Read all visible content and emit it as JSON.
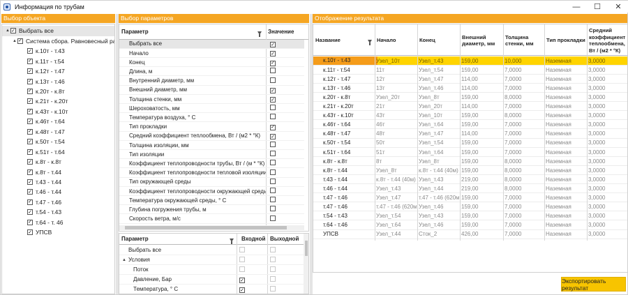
{
  "window": {
    "title": "Информация по трубам",
    "minimize": "—",
    "maximize": "☐",
    "close": "✕"
  },
  "panels": {
    "objects": "Выбор объекта",
    "params": "Выбор параметров",
    "results": "Отображение результата"
  },
  "tree": [
    {
      "label": "Выбрать все",
      "level": 0,
      "checked": true,
      "expander": "▲",
      "selected": true
    },
    {
      "label": "Система сбора. Равновесный расчет",
      "level": 1,
      "checked": true,
      "expander": "▲"
    },
    {
      "label": "к.10т - т.43",
      "level": 2,
      "checked": true
    },
    {
      "label": "к.11т - т.54",
      "level": 2,
      "checked": true
    },
    {
      "label": "к.12т - т.47",
      "level": 2,
      "checked": true
    },
    {
      "label": "к.13т - т.46",
      "level": 2,
      "checked": true
    },
    {
      "label": "к.20т - к.8т",
      "level": 2,
      "checked": true
    },
    {
      "label": "к.21т - к.20т",
      "level": 2,
      "checked": true
    },
    {
      "label": "к.43т - к.10т",
      "level": 2,
      "checked": true
    },
    {
      "label": "к.46т - т.64",
      "level": 2,
      "checked": true
    },
    {
      "label": "к.48т - т.47",
      "level": 2,
      "checked": true
    },
    {
      "label": "к.50т - т.54",
      "level": 2,
      "checked": true
    },
    {
      "label": "к.51т - т.64",
      "level": 2,
      "checked": true
    },
    {
      "label": "к.8т - к.8т",
      "level": 2,
      "checked": true
    },
    {
      "label": "к.8т - т.44",
      "level": 2,
      "checked": true
    },
    {
      "label": "т.43 - т.44",
      "level": 2,
      "checked": true
    },
    {
      "label": "т.46 - т.44",
      "level": 2,
      "checked": true
    },
    {
      "label": "т.47 - т.46",
      "level": 2,
      "checked": true
    },
    {
      "label": "т.54 - т.43",
      "level": 2,
      "checked": true
    },
    {
      "label": "т.64 - т. 46",
      "level": 2,
      "checked": true
    },
    {
      "label": "УПСВ",
      "level": 2,
      "checked": true
    }
  ],
  "params_grid": {
    "col_param": "Параметр",
    "col_value": "Значение",
    "rows": [
      {
        "name": "Выбрать все",
        "checked": true,
        "selected": true
      },
      {
        "name": "Начало",
        "checked": true
      },
      {
        "name": "Конец",
        "checked": true
      },
      {
        "name": "Длина, м",
        "checked": false
      },
      {
        "name": "Внутренний диаметр,  мм",
        "checked": false
      },
      {
        "name": "Внешний диаметр, мм",
        "checked": true
      },
      {
        "name": "Толщина стенки, мм",
        "checked": true
      },
      {
        "name": "Шероховатость, мм",
        "checked": false
      },
      {
        "name": "Температура воздуха, ° С",
        "checked": false
      },
      {
        "name": "Тип прокладки",
        "checked": true
      },
      {
        "name": "Средний коэффициент теплообмена, Вт / (м2 * °К)",
        "checked": true
      },
      {
        "name": "Толщина изоляции, мм",
        "checked": false
      },
      {
        "name": "Тип изоляции",
        "checked": false
      },
      {
        "name": "Коэффициент теплопроводности трубы, Вт / (м * °К)",
        "checked": false
      },
      {
        "name": "Коэффициент теплопроводности тепловой изоляции, Вт / (",
        "checked": false
      },
      {
        "name": "Тип окружающей среды",
        "checked": false
      },
      {
        "name": "Коэффициент теплопроводности окружающей среды, Вт / (",
        "checked": false
      },
      {
        "name": "Температура окружающей среды, ° С",
        "checked": false
      },
      {
        "name": "Глубина погружения трубы,  м",
        "checked": false
      },
      {
        "name": "Скорость ветра, м/с",
        "checked": false
      }
    ]
  },
  "io_grid": {
    "col_param": "Параметр",
    "col_in": "Входной",
    "col_out": "Выходной",
    "rows": [
      {
        "name": "Выбрать все",
        "indent": 0,
        "in": false,
        "out": false
      },
      {
        "name": "Условия",
        "indent": 0,
        "expander": "▲",
        "in": false,
        "out": false
      },
      {
        "name": "Поток",
        "indent": 1,
        "in": false,
        "out": false
      },
      {
        "name": "Давление, Бар",
        "indent": 1,
        "in": true,
        "out": false
      },
      {
        "name": "Температура, ° С",
        "indent": 1,
        "in": true,
        "out": false
      }
    ]
  },
  "results": {
    "headers": [
      "Название",
      "Начало",
      "Конец",
      "Внешний диаметр, мм",
      "Толщина стенки, мм",
      "Тип прокладки",
      "Средний коэффициент теплообмена, Вт / (м2 * °К)"
    ],
    "rows": [
      [
        "к.10т - т.43",
        "Узел_10т",
        "Узел_т.43",
        "159,00",
        "10,000",
        "Наземная",
        "3,0000"
      ],
      [
        "к.11т - т.54",
        "11т",
        "Узел_т.54",
        "159,00",
        "7,0000",
        "Наземная",
        "3,0000"
      ],
      [
        "к.12т - т.47",
        "12т",
        "Узел_т.47",
        "114,00",
        "7,0000",
        "Наземная",
        "3,0000"
      ],
      [
        "к.13т - т.46",
        "13т",
        "Узел_т.46",
        "114,00",
        "7,0000",
        "Наземная",
        "3,0000"
      ],
      [
        "к.20т - к.8т",
        "Узел_20т",
        "Узел_8т",
        "159,00",
        "8,0000",
        "Наземная",
        "3,0000"
      ],
      [
        "к.21т - к.20т",
        "21т",
        "Узел_20т",
        "114,00",
        "7,0000",
        "Наземная",
        "3,0000"
      ],
      [
        "к.43т - к.10т",
        "43т",
        "Узел_10т",
        "159,00",
        "8,0000",
        "Наземная",
        "3,0000"
      ],
      [
        "к.46т - т.64",
        "46т",
        "Узел_т.64",
        "159,00",
        "7,0000",
        "Наземная",
        "3,0000"
      ],
      [
        "к.48т - т.47",
        "48т",
        "Узел_т.47",
        "114,00",
        "7,0000",
        "Наземная",
        "3,0000"
      ],
      [
        "к.50т - т.54",
        "50т",
        "Узел_т.54",
        "159,00",
        "7,0000",
        "Наземная",
        "3,0000"
      ],
      [
        "к.51т - т.64",
        "51т",
        "Узел_т.64",
        "159,00",
        "7,0000",
        "Наземная",
        "3,0000"
      ],
      [
        "к.8т - к.8т",
        "8т",
        "Узел_8т",
        "159,00",
        "8,0000",
        "Наземная",
        "3,0000"
      ],
      [
        "к.8т - т.44",
        "Узел_8т",
        "к.8т - т.44 (40м)",
        "159,00",
        "8,0000",
        "Наземная",
        "3,0000"
      ],
      [
        "т.43 - т.44",
        "к.8т - т.44 (40м)",
        "Узел_т.43",
        "219,00",
        "8,0000",
        "Наземная",
        "3,0000"
      ],
      [
        "т.46 - т.44",
        "Узел_т.43",
        "Узел_т.44",
        "219,00",
        "8,0000",
        "Наземная",
        "3,0000"
      ],
      [
        "т.47 - т.46",
        "Узел_т.47",
        "т.47 - т.46 (620м)",
        "159,00",
        "7,0000",
        "Наземная",
        "3,0000"
      ],
      [
        "т.47 - т.46",
        "т.47 - т.46 (620м)",
        "Узел_т.46",
        "159,00",
        "7,0000",
        "Наземная",
        "3,0000"
      ],
      [
        "т.54 - т.43",
        "Узел_т.54",
        "Узел_т.43",
        "159,00",
        "7,0000",
        "Наземная",
        "3,0000"
      ],
      [
        "т.64 - т.46",
        "Узел_т.64",
        "Узел_т.46",
        "159,00",
        "7,0000",
        "Наземная",
        "3,0000"
      ],
      [
        "УПСВ",
        "Узел_т.44",
        "Сток_2",
        "426,00",
        "7,0000",
        "Наземная",
        "3,0000"
      ]
    ]
  },
  "export_button": "Экспортировать результат",
  "checkmark": "✓"
}
